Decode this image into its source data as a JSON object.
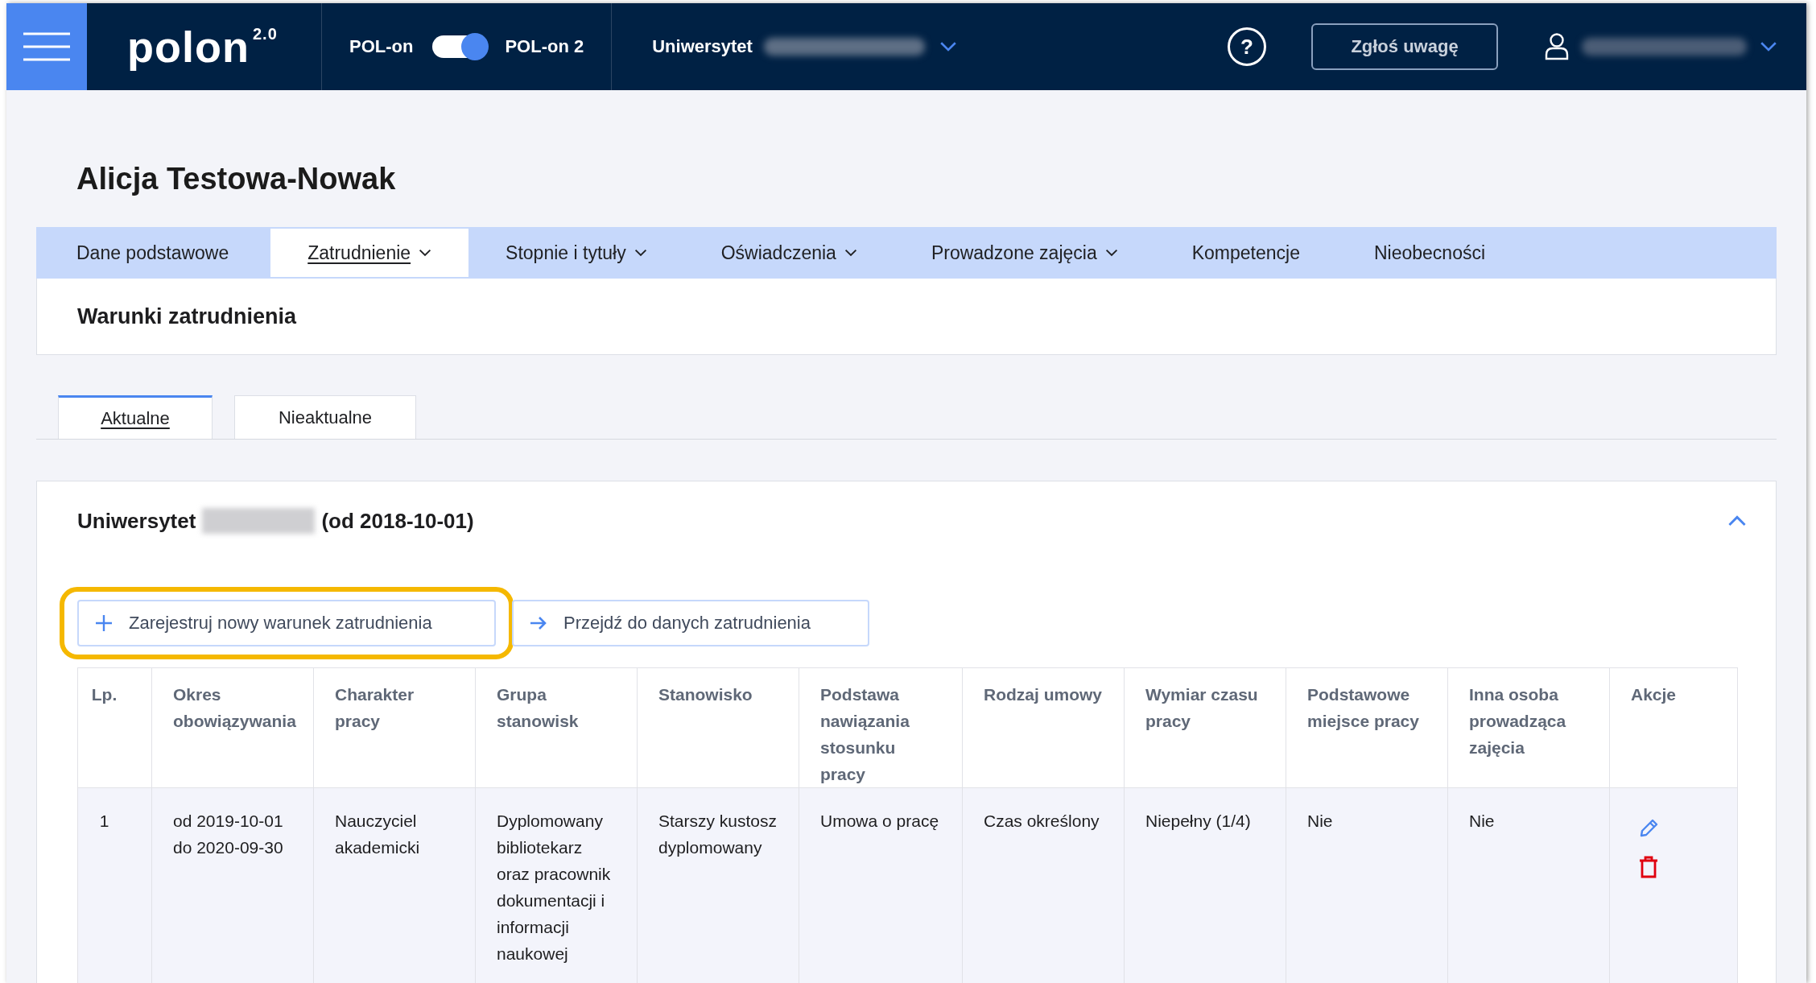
{
  "header": {
    "logo": "polon",
    "logo_version": "2.0",
    "toggle": {
      "left_label": "POL-on",
      "right_label": "POL-on 2",
      "on": true
    },
    "institution": "Uniwersytet",
    "help_button": "?",
    "feedback_button": "Zgłoś uwagę"
  },
  "person_name": "Alicja Testowa-Nowak",
  "tabs": [
    {
      "label": "Dane podstawowe",
      "selected": false,
      "dropdown": false
    },
    {
      "label": "Zatrudnienie",
      "selected": true,
      "dropdown": true
    },
    {
      "label": "Stopnie i tytuły",
      "selected": false,
      "dropdown": true
    },
    {
      "label": "Oświadczenia",
      "selected": false,
      "dropdown": true
    },
    {
      "label": "Prowadzone zajęcia",
      "selected": false,
      "dropdown": true
    },
    {
      "label": "Kompetencje",
      "selected": false,
      "dropdown": false
    },
    {
      "label": "Nieobecności",
      "selected": false,
      "dropdown": false
    }
  ],
  "section_title": "Warunki zatrudnienia",
  "subtabs": [
    {
      "label": "Aktualne",
      "selected": true
    },
    {
      "label": "Nieaktualne",
      "selected": false
    }
  ],
  "panel": {
    "title_prefix": "Uniwersytet",
    "title_suffix": "(od 2018-10-01)",
    "expanded": true,
    "buttons": [
      {
        "label": "Zarejestruj nowy warunek zatrudnienia",
        "kind": "add",
        "highlighted": true
      },
      {
        "label": "Przejdź do danych zatrudnienia",
        "kind": "go",
        "highlighted": false
      }
    ],
    "table": {
      "columns": [
        "Lp.",
        "Okres obowiązywania",
        "Charakter pracy",
        "Grupa stanowisk",
        "Stanowisko",
        "Podstawa nawiązania stosunku pracy",
        "Rodzaj umowy",
        "Wymiar czasu pracy",
        "Podstawowe miejsce pracy",
        "Inna osoba prowadząca zajęcia",
        "Akcje"
      ],
      "rows": [
        {
          "cells": [
            "1",
            "od 2019-10-01 do 2020-09-30",
            "Nauczyciel akademicki",
            "Dyplomowany bibliotekarz oraz pracownik dokumentacji i informacji naukowej",
            "Starszy kustosz dyplomowany",
            "Umowa o pracę",
            "Czas określony",
            "Niepełny (1/4)",
            "Nie",
            "Nie"
          ]
        }
      ]
    }
  }
}
